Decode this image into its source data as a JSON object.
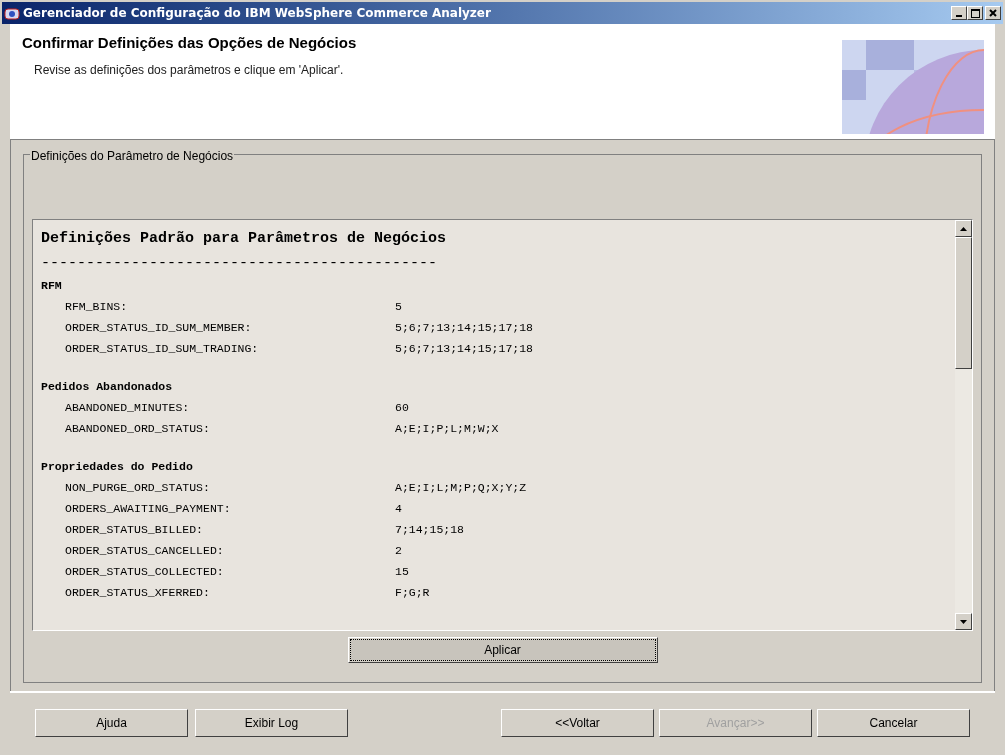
{
  "window": {
    "title": "Gerenciador de Configuração do IBM WebSphere Commerce Analyzer"
  },
  "header": {
    "title": "Confirmar Definições das Opções de Negócios",
    "subtitle": "Revise as definições dos parâmetros e clique em 'Aplicar'."
  },
  "group": {
    "title": "Definições do Parâmetro de Negócios",
    "heading": "Definições Padrão para Parâmetros de Negócios",
    "rule": "--------------------------------------------",
    "sections": [
      {
        "title": "RFM",
        "params": [
          {
            "name": "RFM_BINS:",
            "value": "5"
          },
          {
            "name": "ORDER_STATUS_ID_SUM_MEMBER:",
            "value": "5;6;7;13;14;15;17;18"
          },
          {
            "name": "ORDER_STATUS_ID_SUM_TRADING:",
            "value": "5;6;7;13;14;15;17;18"
          }
        ]
      },
      {
        "title": "Pedidos Abandonados",
        "params": [
          {
            "name": "ABANDONED_MINUTES:",
            "value": "60"
          },
          {
            "name": "ABANDONED_ORD_STATUS:",
            "value": "A;E;I;P;L;M;W;X"
          }
        ]
      },
      {
        "title": "Propriedades do Pedido",
        "params": [
          {
            "name": "NON_PURGE_ORD_STATUS:",
            "value": "A;E;I;L;M;P;Q;X;Y;Z"
          },
          {
            "name": "ORDERS_AWAITING_PAYMENT:",
            "value": "4"
          },
          {
            "name": "ORDER_STATUS_BILLED:",
            "value": "7;14;15;18"
          },
          {
            "name": "ORDER_STATUS_CANCELLED:",
            "value": "2"
          },
          {
            "name": "ORDER_STATUS_COLLECTED:",
            "value": "15"
          },
          {
            "name": "ORDER_STATUS_XFERRED:",
            "value": "F;G;R"
          }
        ]
      }
    ]
  },
  "apply_button": {
    "label": "Aplicar",
    "focused": true
  },
  "footer_buttons": [
    {
      "label": "Ajuda",
      "disabled": false
    },
    {
      "label": "Exibir Log",
      "disabled": false
    },
    {
      "label": "<<Voltar",
      "disabled": false
    },
    {
      "label": "Avançar>>",
      "disabled": true
    },
    {
      "label": "Cancelar",
      "disabled": false
    }
  ]
}
